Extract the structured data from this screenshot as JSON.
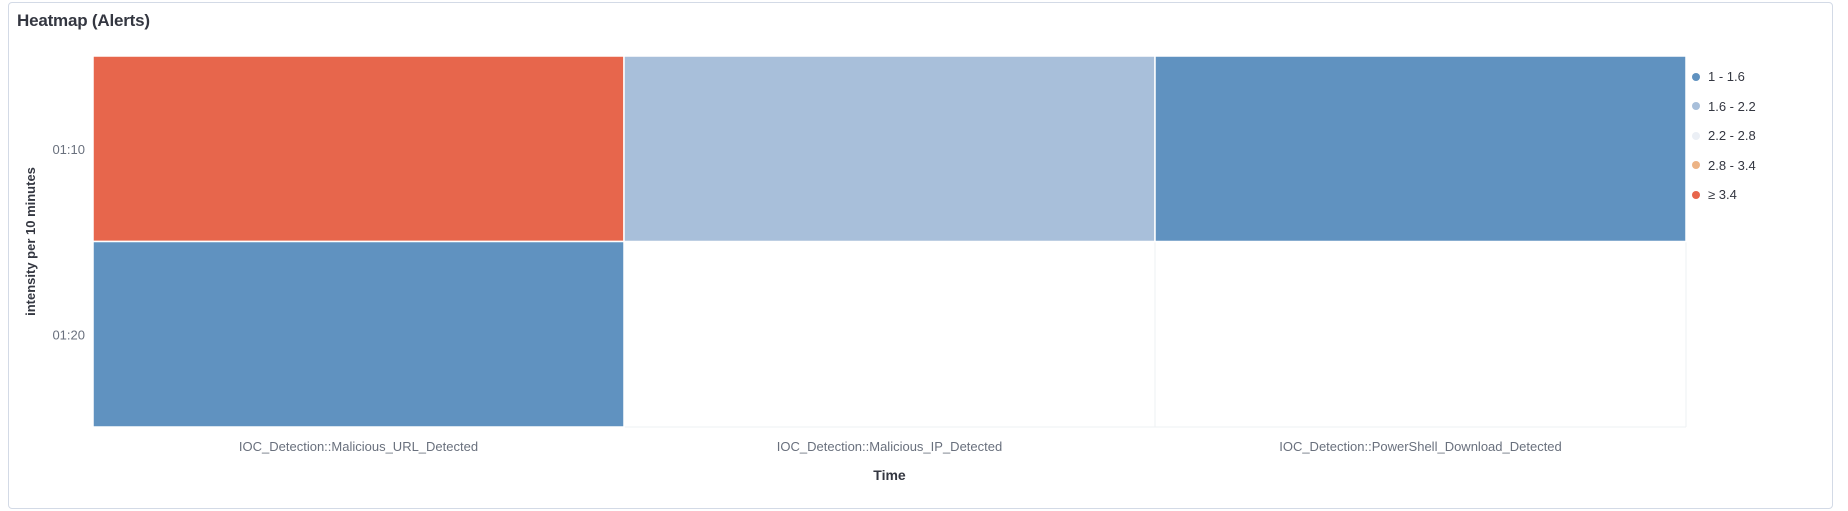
{
  "panel": {
    "title": "Heatmap (Alerts)"
  },
  "chart_data": {
    "type": "heatmap",
    "title": "Heatmap (Alerts)",
    "xlabel": "Time",
    "ylabel": "intensity per 10 minutes",
    "x_categories": [
      "IOC_Detection::Malicious_URL_Detected",
      "IOC_Detection::Malicious_IP_Detected",
      "IOC_Detection::PowerShell_Download_Detected"
    ],
    "y_categories": [
      "01:10",
      "01:20"
    ],
    "cells": [
      {
        "x": "IOC_Detection::Malicious_URL_Detected",
        "y": "01:10",
        "range": "≥ 3.4"
      },
      {
        "x": "IOC_Detection::Malicious_IP_Detected",
        "y": "01:10",
        "range": "1.6 - 2.2"
      },
      {
        "x": "IOC_Detection::PowerShell_Download_Detected",
        "y": "01:10",
        "range": "1 - 1.6"
      },
      {
        "x": "IOC_Detection::Malicious_URL_Detected",
        "y": "01:20",
        "range": "1 - 1.6"
      }
    ],
    "legend": {
      "placement": "right",
      "items": [
        {
          "label": "1 - 1.6",
          "color": "#6092c0"
        },
        {
          "label": "1.6 - 2.2",
          "color": "#a8bfda"
        },
        {
          "label": "2.2 - 2.8",
          "color": "#ebeff5"
        },
        {
          "label": "2.8 - 3.4",
          "color": "#ecb385"
        },
        {
          "label": "≥ 3.4",
          "color": "#e7664c"
        }
      ]
    },
    "grid": true
  }
}
